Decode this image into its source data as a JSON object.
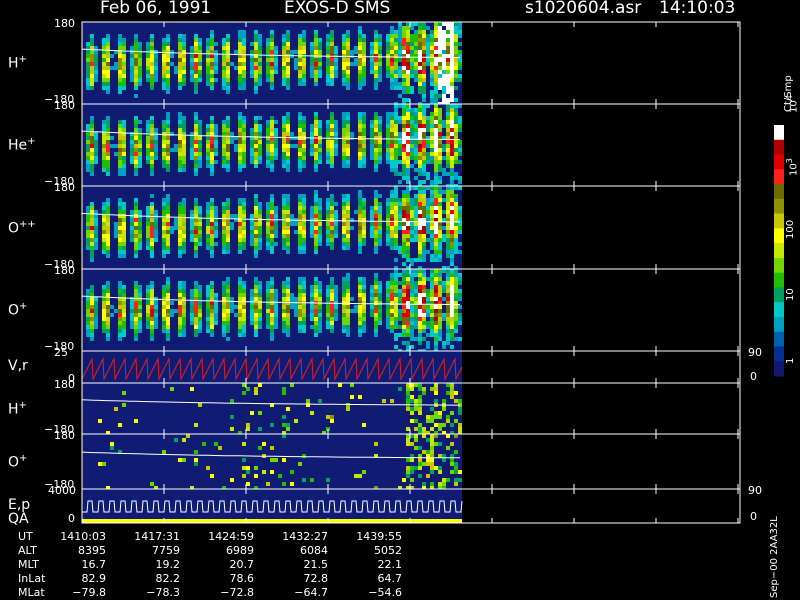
{
  "header": {
    "date": "Feb 06, 1991",
    "instrument": "EXOS-D SMS",
    "file": "s1020604.asr",
    "time": "14:10:03"
  },
  "panels": [
    {
      "id": "hplus-angle",
      "label": "H",
      "sup": "+",
      "y_top": "180",
      "y_bottom": "−180"
    },
    {
      "id": "heplus-angle",
      "label": "He",
      "sup": "+",
      "y_top": "180",
      "y_bottom": "−180"
    },
    {
      "id": "oplusplus-angle",
      "label": "O",
      "sup": "++",
      "y_top": "180",
      "y_bottom": "−180"
    },
    {
      "id": "oplus-angle",
      "label": "O",
      "sup": "+",
      "y_top": "180",
      "y_bottom": "−180"
    },
    {
      "id": "vr",
      "label": "V,r",
      "sup": "",
      "y_top": "25",
      "y_bottom": "0",
      "right_top": "90",
      "right_bottom": "0"
    },
    {
      "id": "hplus-angle-2",
      "label": "H",
      "sup": "+",
      "y_top": "180",
      "y_bottom": "−180"
    },
    {
      "id": "oplus-angle-2",
      "label": "O",
      "sup": "+",
      "y_top": "180",
      "y_bottom": "−180"
    },
    {
      "id": "ep-qa",
      "label": "E,p",
      "label2": "QA",
      "sup": "",
      "y_top": "4000",
      "y_bottom": "0",
      "right_top": "90",
      "right_bottom": "0"
    }
  ],
  "colorbar": {
    "unit": "Ct/Smp",
    "labels": [
      {
        "text": "10",
        "sup": "4",
        "level": 4
      },
      {
        "text": "10",
        "sup": "3",
        "level": 3
      },
      {
        "text": "100",
        "sup": "",
        "level": 2
      },
      {
        "text": "10",
        "sup": "",
        "level": 1
      },
      {
        "text": "1",
        "sup": "",
        "level": 0
      }
    ],
    "colors": [
      "#ffffff",
      "#b00000",
      "#e00000",
      "#ff2020",
      "#6b6b00",
      "#909000",
      "#c8c800",
      "#ffff00",
      "#c8e800",
      "#70d800",
      "#20c000",
      "#00a060",
      "#00c8c8",
      "#00a0c0",
      "#0060b0",
      "#003090",
      "#101870"
    ]
  },
  "footer": {
    "row_labels": [
      "UT",
      "ALT",
      "MLT",
      "InLat",
      "MLat"
    ],
    "columns": [
      [
        "1410:03",
        "8395",
        "16.7",
        "82.9",
        "−79.8"
      ],
      [
        "1417:31",
        "7759",
        "19.2",
        "82.2",
        "−78.3"
      ],
      [
        "1424:59",
        "6989",
        "20.7",
        "78.6",
        "−72.8"
      ],
      [
        "1432:27",
        "6084",
        "21.5",
        "72.8",
        "−64.7"
      ],
      [
        "1439:55",
        "5052",
        "22.1",
        "64.7",
        "−54.6"
      ]
    ],
    "side_id": "Sep−00  2AA32L"
  },
  "chart_data": {
    "type": "heatmap",
    "title": "Feb 06, 1991   EXOS-D SMS",
    "x_ticks": [
      "1410:03",
      "1417:31",
      "1424:59",
      "1432:27",
      "1439:55"
    ],
    "colorbar_range_log10": [
      0,
      4
    ],
    "colorbar_unit": "Ct/Smp",
    "spectrogram_panels": [
      "H+",
      "He+",
      "O++",
      "O+",
      "H+",
      "O+"
    ],
    "pitch_angle_range": [
      -180,
      180
    ],
    "vr_range": [
      0,
      25
    ],
    "vr_right_range": [
      0,
      90
    ],
    "energy_range": [
      0,
      4000
    ],
    "energy_right_range": [
      0,
      90
    ]
  }
}
